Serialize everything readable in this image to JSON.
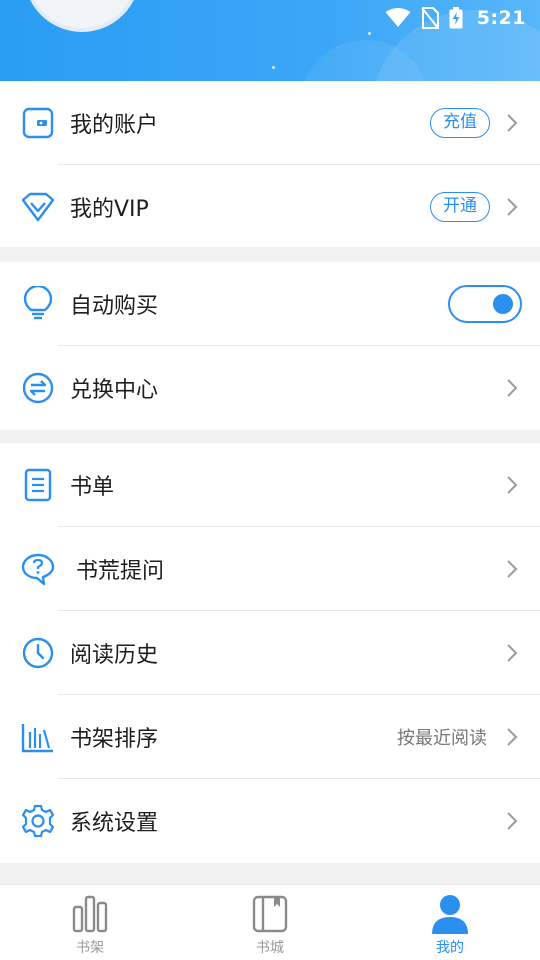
{
  "status_bar": {
    "time": "5:21",
    "wifi_icon": "wifi-icon",
    "no_sim_icon": "no-sim-icon",
    "battery_icon": "battery-charging-icon"
  },
  "header": {
    "avatar_icon": "avatar"
  },
  "section1": {
    "items": [
      {
        "label": "我的账户",
        "action": "充值",
        "icon": "wallet-icon"
      },
      {
        "label": "我的VIP",
        "action": "开通",
        "icon": "diamond-icon"
      }
    ]
  },
  "section2": {
    "items": [
      {
        "label": "自动购买",
        "icon": "lightbulb-icon",
        "toggle_on": true
      },
      {
        "label": "兑换中心",
        "icon": "exchange-icon"
      }
    ]
  },
  "section3": {
    "items": [
      {
        "label": "书单",
        "icon": "booklist-icon"
      },
      {
        "label": "书荒提问",
        "icon": "question-bubble-icon"
      },
      {
        "label": "阅读历史",
        "icon": "clock-icon"
      },
      {
        "label": "书架排序",
        "icon": "sort-bars-icon",
        "value": "按最近阅读"
      },
      {
        "label": "系统设置",
        "icon": "gear-icon"
      }
    ]
  },
  "bottom_nav": {
    "items": [
      {
        "label": "书架",
        "icon": "bookshelf-icon"
      },
      {
        "label": "书城",
        "icon": "bookstore-icon"
      },
      {
        "label": "我的",
        "icon": "person-icon",
        "active": true
      }
    ]
  },
  "colors": {
    "accent": "#2b8ff0",
    "header_start": "#2a9df3",
    "header_end": "#58b6fa",
    "background": "#f2f2f2"
  }
}
